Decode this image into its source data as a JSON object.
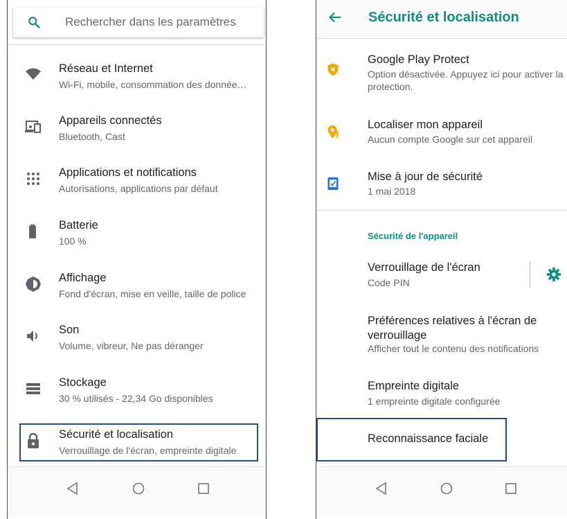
{
  "left": {
    "search": {
      "placeholder": "Rechercher dans les paramètres"
    },
    "items": [
      {
        "title": "Réseau et Internet",
        "subtitle": "Wi-Fi, mobile, consommation des donnée…",
        "icon": "wifi-icon"
      },
      {
        "title": "Appareils connectés",
        "subtitle": "Bluetooth, Cast",
        "icon": "devices-icon"
      },
      {
        "title": "Applications et notifications",
        "subtitle": "Autorisations, applications par défaut",
        "icon": "apps-icon"
      },
      {
        "title": "Batterie",
        "subtitle": "100 %",
        "icon": "battery-icon"
      },
      {
        "title": "Affichage",
        "subtitle": "Fond d'écran, mise en veille, taille de police",
        "icon": "brightness-icon"
      },
      {
        "title": "Son",
        "subtitle": "Volume, vibreur, Ne pas déranger",
        "icon": "volume-icon"
      },
      {
        "title": "Stockage",
        "subtitle": "30 % utilisés - 22,34 Go disponibles",
        "icon": "storage-icon"
      },
      {
        "title": "Sécurité et localisation",
        "subtitle": "Verrouillage de l'écran, empreinte digitale",
        "icon": "lock-icon"
      }
    ]
  },
  "right": {
    "appbar": {
      "title": "Sécurité et localisation"
    },
    "items": [
      {
        "title": "Google Play Protect",
        "subtitle": "Option désactivée. Appuyez ici pour activer la protection.",
        "icon": "shield-icon"
      },
      {
        "title": "Localiser mon appareil",
        "subtitle": "Aucun compte Google sur cet appareil",
        "icon": "find-device-icon"
      },
      {
        "title": "Mise à jour de sécurité",
        "subtitle": "1 mai 2018",
        "icon": "security-update-icon"
      }
    ],
    "section_header": "Sécurité de l'appareil",
    "device_items": [
      {
        "title": "Verrouillage de l'écran",
        "subtitle": "Code PIN"
      },
      {
        "title": "Préférences relatives à l'écran de verrouillage",
        "subtitle": "Afficher tout le contenu des notifications"
      },
      {
        "title": "Empreinte digitale",
        "subtitle": "1 empreinte digitale configurée"
      },
      {
        "title": "Reconnaissance faciale"
      }
    ]
  },
  "colors": {
    "accent": "#0f8f80",
    "highlight": "#1f4e8c",
    "warning": "#f4a800"
  }
}
